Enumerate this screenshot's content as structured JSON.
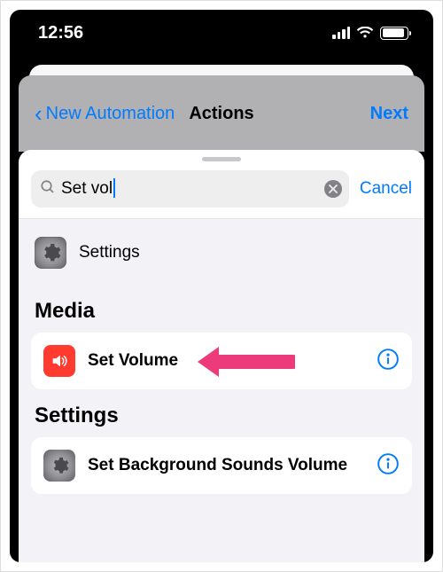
{
  "statusbar": {
    "time": "12:56"
  },
  "background_nav": {
    "back_label": "New Automation",
    "title": "Actions",
    "next_label": "Next"
  },
  "search": {
    "value": "Set vol",
    "cancel_label": "Cancel"
  },
  "provider": {
    "label": "Settings"
  },
  "sections": [
    {
      "header": "Media",
      "items": [
        {
          "title": "Set Volume",
          "icon": "speaker-icon",
          "color": "red"
        }
      ]
    },
    {
      "header": "Settings",
      "items": [
        {
          "title": "Set Background Sounds Volume",
          "icon": "settings-gear-icon",
          "color": "gray"
        }
      ]
    }
  ],
  "colors": {
    "accent": "#007aff",
    "pink_arrow": "#ec3a7b"
  }
}
